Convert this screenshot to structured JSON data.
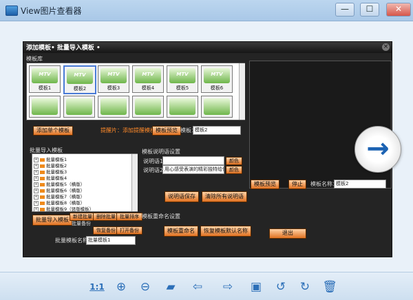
{
  "window": {
    "title": "View图片查看器",
    "min_label": "—",
    "max_label": "☐",
    "close_label": "✕"
  },
  "screenshot": {
    "dialog_title": "添加模板• 批量导入模板 •",
    "close_glyph": "×",
    "template_library_label": "模板库",
    "templates": [
      {
        "mtv": "MTV",
        "name": "模板1"
      },
      {
        "mtv": "MTV",
        "name": "模板2"
      },
      {
        "mtv": "MTV",
        "name": "模板3"
      },
      {
        "mtv": "MTV",
        "name": "模板4"
      },
      {
        "mtv": "MTV",
        "name": "模板5"
      },
      {
        "mtv": "MTV",
        "name": "模板6"
      }
    ],
    "add_single_button": "添加单个模板",
    "hint_text": "提醒片：添加提醒模板：",
    "preview_button": "模板预览",
    "template_label": "模板：",
    "template_value": "模板2",
    "batch_label": "批量导入模板",
    "tree_items": [
      "批量模板1",
      "批量模板2",
      "批量模板3",
      "批量模板4",
      "批量模板5（横版）",
      "批量模板6（横版）",
      "批量模板7（横版）",
      "批量模板8（横版）",
      "批量模板9（竖版模板）"
    ],
    "batch_import_button": "批量导入模板",
    "new_batch_button": "新建批量",
    "delete_batch_button": "删除批量",
    "batch_sort_button": "批量排序",
    "batch_backup_label": "批量备份",
    "restore_backup_button": "恢复备份",
    "open_backup_button": "打开备份",
    "batch_name_label": "批量模板名称：",
    "batch_name_value": "批量模板1",
    "subtitle_settings_label": "模板说明语设置",
    "subtitle1_label": "说明语1：",
    "subtitle1_value": "",
    "subtitle2_label": "说明语2：",
    "subtitle2_value": "用心感受表演的精彩独特给你",
    "color_button_1": "颜色",
    "color_button_2": "颜色",
    "save_subtitle_button": "说明语保存",
    "clear_subtitle_button": "清除所有说明语",
    "rename_settings_label": "模板重命名设置",
    "rename_button": "模板重命名",
    "restore_name_button": "恢复模板默认名称",
    "preview_panel_button": "模板预览",
    "stop_button": "停止",
    "template_name_label": "模板名称：",
    "template_name_value": "模板2",
    "exit_button": "退出"
  },
  "viewer": {
    "next_glyph": "→"
  },
  "toolbar": {
    "actual_size": "1:1",
    "zoom_in": "⊕",
    "zoom_out": "⊖",
    "open_folder": "▰",
    "prev": "⇦",
    "next": "⇨",
    "save": "▣",
    "rotate_left": "↺",
    "rotate_right": "↻",
    "delete": "🗑"
  },
  "colors": {
    "accent_blue": "#1d63b3",
    "orange_button": "#e07222",
    "dialog_bg": "#242424"
  }
}
